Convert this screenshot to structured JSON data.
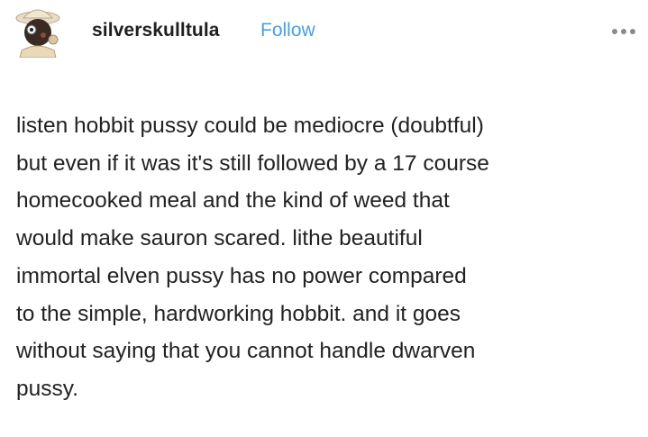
{
  "post": {
    "username": "silverskulltula",
    "follow_label": "Follow",
    "more_icon": "ellipsis-icon",
    "avatar_icon": "avatar-icon",
    "lines": [
      "listen hobbit pussy could be mediocre (doubtful)",
      "but even if it was it's still followed by a 17 course",
      "homecooked meal and the kind of weed that",
      "would make sauron scared. lithe beautiful",
      "immortal elven pussy has no power compared",
      "to the simple, hardworking hobbit. and it goes",
      "without saying that you cannot handle dwarven",
      "pussy."
    ]
  },
  "colors": {
    "follow": "#4a9fe0",
    "text": "#222222",
    "background": "#ffffff"
  }
}
